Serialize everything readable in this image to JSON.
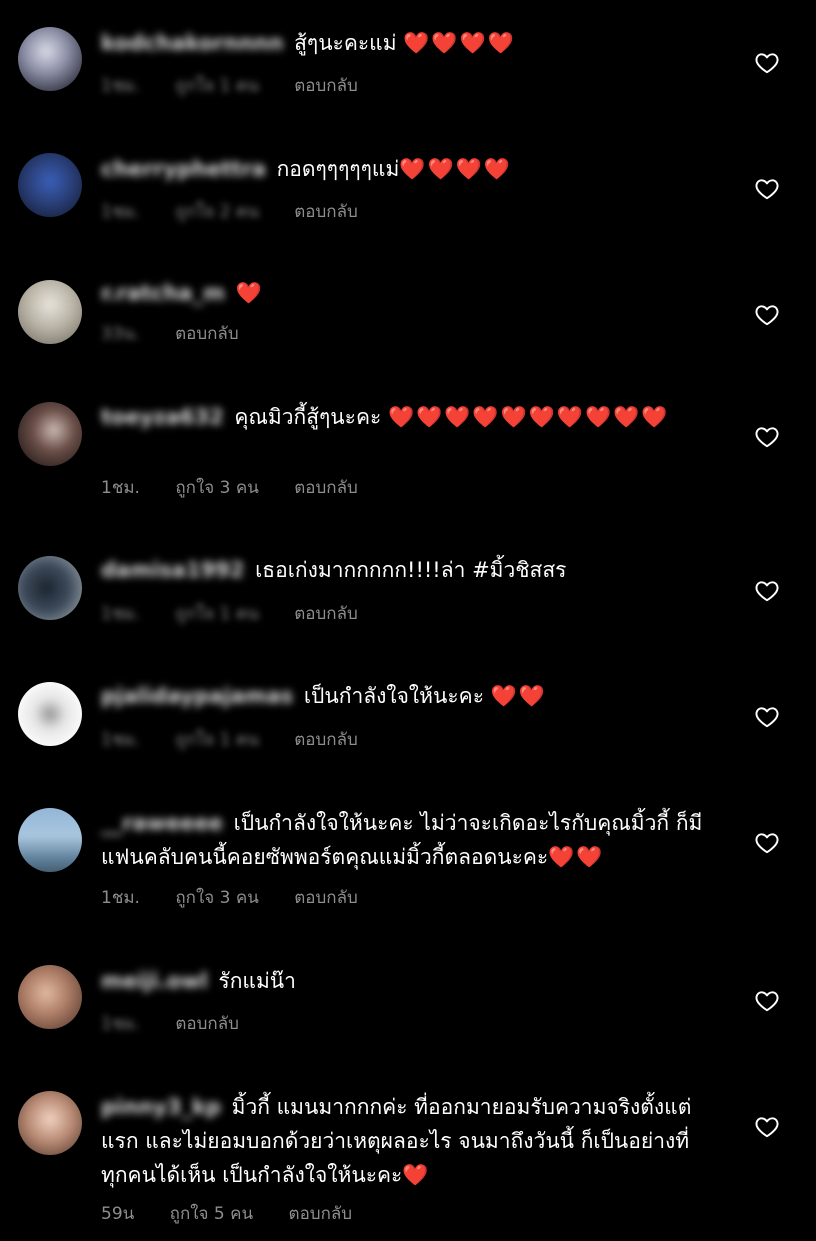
{
  "comments": [
    {
      "username": "kodchakornnnn",
      "text": "สู้ๆนะคะแม่",
      "hearts": "❤️❤️❤️❤️",
      "time": "1ชม.",
      "likes": "ถูกใจ 1 คน",
      "reply": "ตอบกลับ"
    },
    {
      "username": "cherryphettra",
      "text": "กอดๆๆๆๆๆแม่",
      "hearts": "❤️❤️❤️❤️",
      "time": "1ชม.",
      "likes": "ถูกใจ 2 คน",
      "reply": "ตอบกลับ"
    },
    {
      "username": "r.ratcha_m",
      "text": "",
      "hearts": "❤️",
      "time": "33น.",
      "likes": "",
      "reply": "ตอบกลับ"
    },
    {
      "username": "toeyza632",
      "text": "คุณมิวกี้สู้ๆนะคะ",
      "hearts": "❤️❤️❤️❤️❤️❤️❤️❤️❤️❤️",
      "time": "1ชม.",
      "likes": "ถูกใจ 3 คน",
      "reply": "ตอบกลับ"
    },
    {
      "username": "damisa1992",
      "text": "เธอเก่งมากกกกก!!!!ล่า #มิ้วชิสสร",
      "hearts": "",
      "time": "1ชม.",
      "likes": "ถูกใจ 1 คน",
      "reply": "ตอบกลับ"
    },
    {
      "username": "pjalidaypajamas",
      "text": "เป็นกำลังใจให้นะคะ",
      "hearts": "❤️❤️",
      "time": "1ชม.",
      "likes": "ถูกใจ 1 คน",
      "reply": "ตอบกลับ"
    },
    {
      "username": "__raweeee",
      "text": "เป็นกำลังใจให้นะคะ ไม่ว่าจะเกิดอะไรกับคุณมิ้วกี้ ก็มีแฟนคลับคนนี้คอยซัพพอร์ตคุณแม่มิ้วกี้ตลอดนะคะ",
      "hearts": "❤️❤️",
      "time": "1ชม.",
      "likes": "ถูกใจ 3 คน",
      "reply": "ตอบกลับ"
    },
    {
      "username": "meiji.owl",
      "text": "รักแม่น๊า",
      "hearts": "",
      "time": "1ชม.",
      "likes": "",
      "reply": "ตอบกลับ"
    },
    {
      "username": "pinny3_kp",
      "text": "มิ้วกี้ แมนมากกกค่ะ ที่ออกมายอมรับความจริงตั้งแต่แรก และไม่ยอมบอกด้วยว่าเหตุผลอะไร จนมาถึงวันนี้ ก็เป็นอย่างที่ทุกคนได้เห็น เป็นกำลังใจให้นะคะ",
      "hearts": "❤️",
      "time": "59น",
      "likes": "ถูกใจ 5 คน",
      "reply": "ตอบกลับ"
    }
  ],
  "colors": {
    "background": "#000000",
    "text": "#ffffff",
    "meta": "#8e8e8e",
    "heart": "#ed2a3a"
  },
  "icons": {
    "like": "heart-outline-icon"
  }
}
